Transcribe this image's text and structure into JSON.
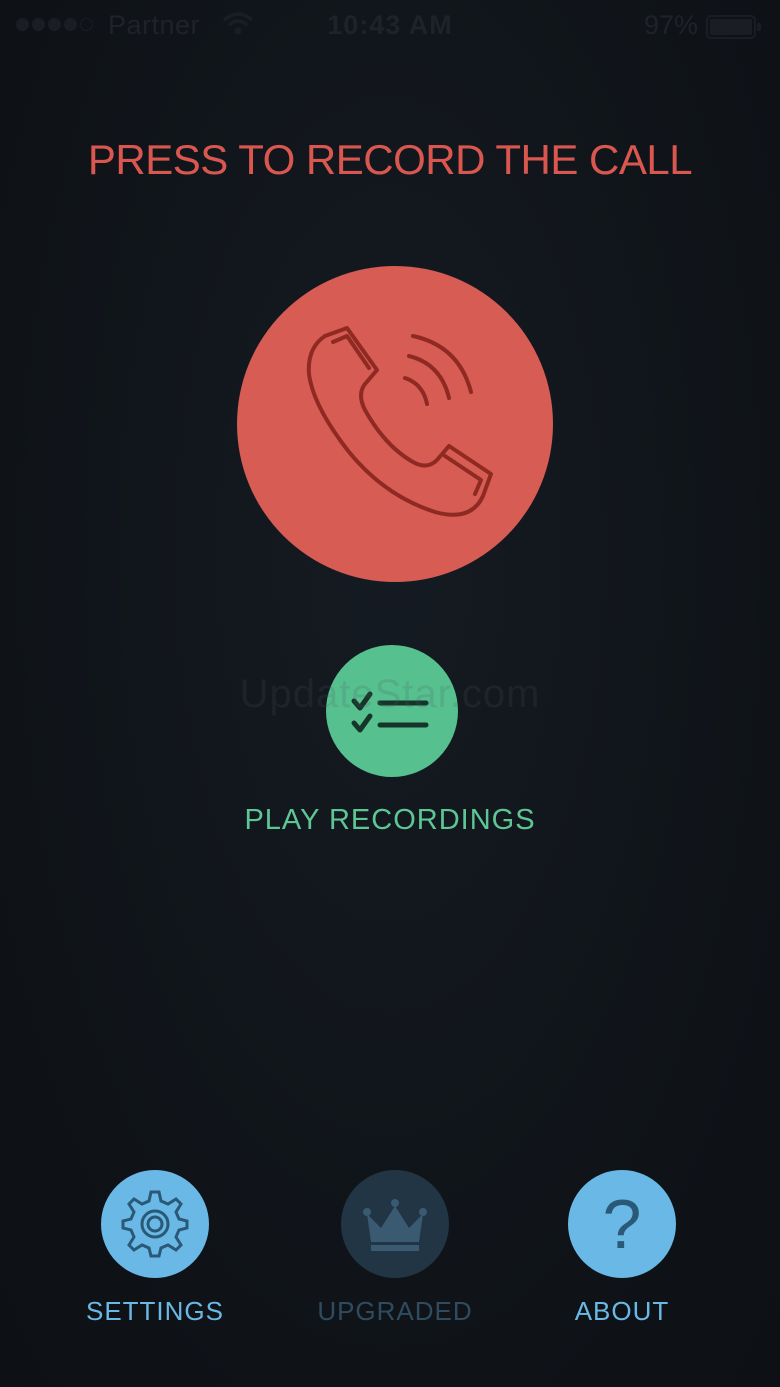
{
  "status_bar": {
    "carrier": "Partner",
    "time": "10:43 AM",
    "battery_percent": "97%",
    "signal_bars_filled": 4,
    "signal_bars_total": 5,
    "battery_level": 0.97
  },
  "headline": "PRESS TO RECORD THE CALL",
  "record_button": {
    "icon": "phone-ringing-icon"
  },
  "watermark": "UpdateStar.com",
  "play": {
    "icon": "checklist-icon",
    "label": "PLAY RECORDINGS"
  },
  "bottom_nav": {
    "settings": {
      "icon": "gear-icon",
      "label": "SETTINGS"
    },
    "upgraded": {
      "icon": "crown-icon",
      "label": "UPGRADED"
    },
    "about": {
      "icon": "question-icon",
      "label": "ABOUT",
      "glyph": "?"
    }
  },
  "colors": {
    "record": "#d65c54",
    "headline": "#d9574f",
    "play": "#56c08e",
    "nav_active": "#6ab8e6",
    "nav_disabled": "#223545",
    "background": "#101419"
  }
}
